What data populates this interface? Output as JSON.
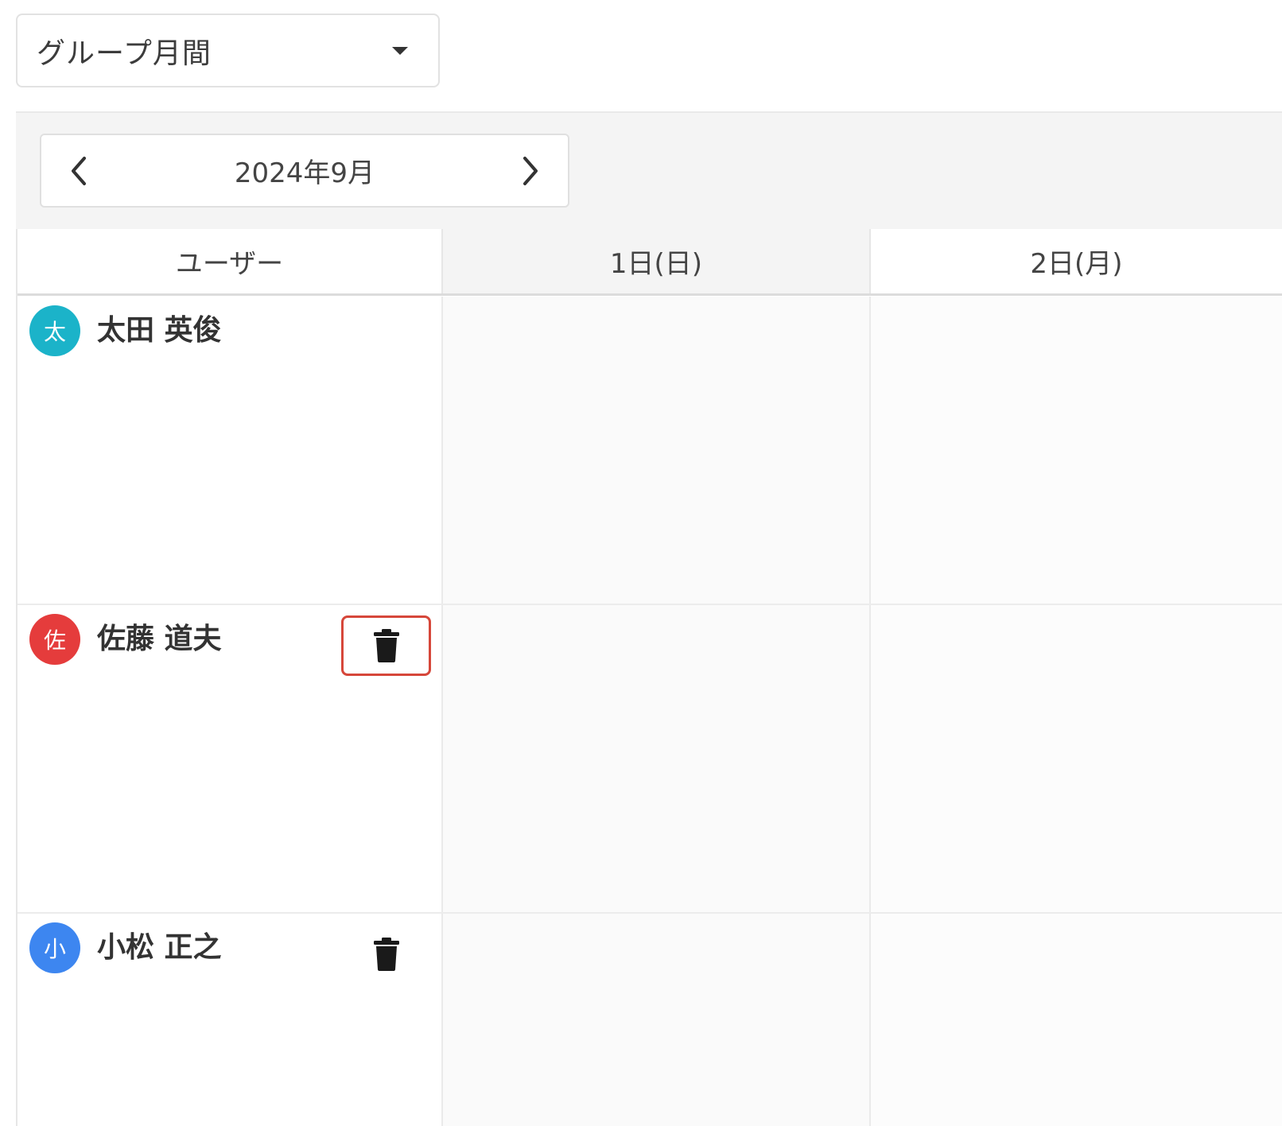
{
  "view_selector": {
    "selected": "グループ月間"
  },
  "month_nav": {
    "label": "2024年9月"
  },
  "grid": {
    "headers": {
      "user": "ユーザー",
      "days": [
        "1日(日)",
        "2日(月)"
      ]
    },
    "users": [
      {
        "initial": "太",
        "name": "太田 英俊",
        "avatar_color": "#1bb3c9",
        "has_delete": false
      },
      {
        "initial": "佐",
        "name": "佐藤 道夫",
        "avatar_color": "#e53c3c",
        "has_delete": true
      },
      {
        "initial": "小",
        "name": "小松 正之",
        "avatar_color": "#3d86f0",
        "has_delete": true
      }
    ]
  },
  "colors": {
    "focus_outline": "#d6473a"
  },
  "icons": {
    "prev": "chevron-left-icon",
    "next": "chevron-right-icon",
    "delete": "trash-icon",
    "dropdown": "caret-down-icon"
  }
}
